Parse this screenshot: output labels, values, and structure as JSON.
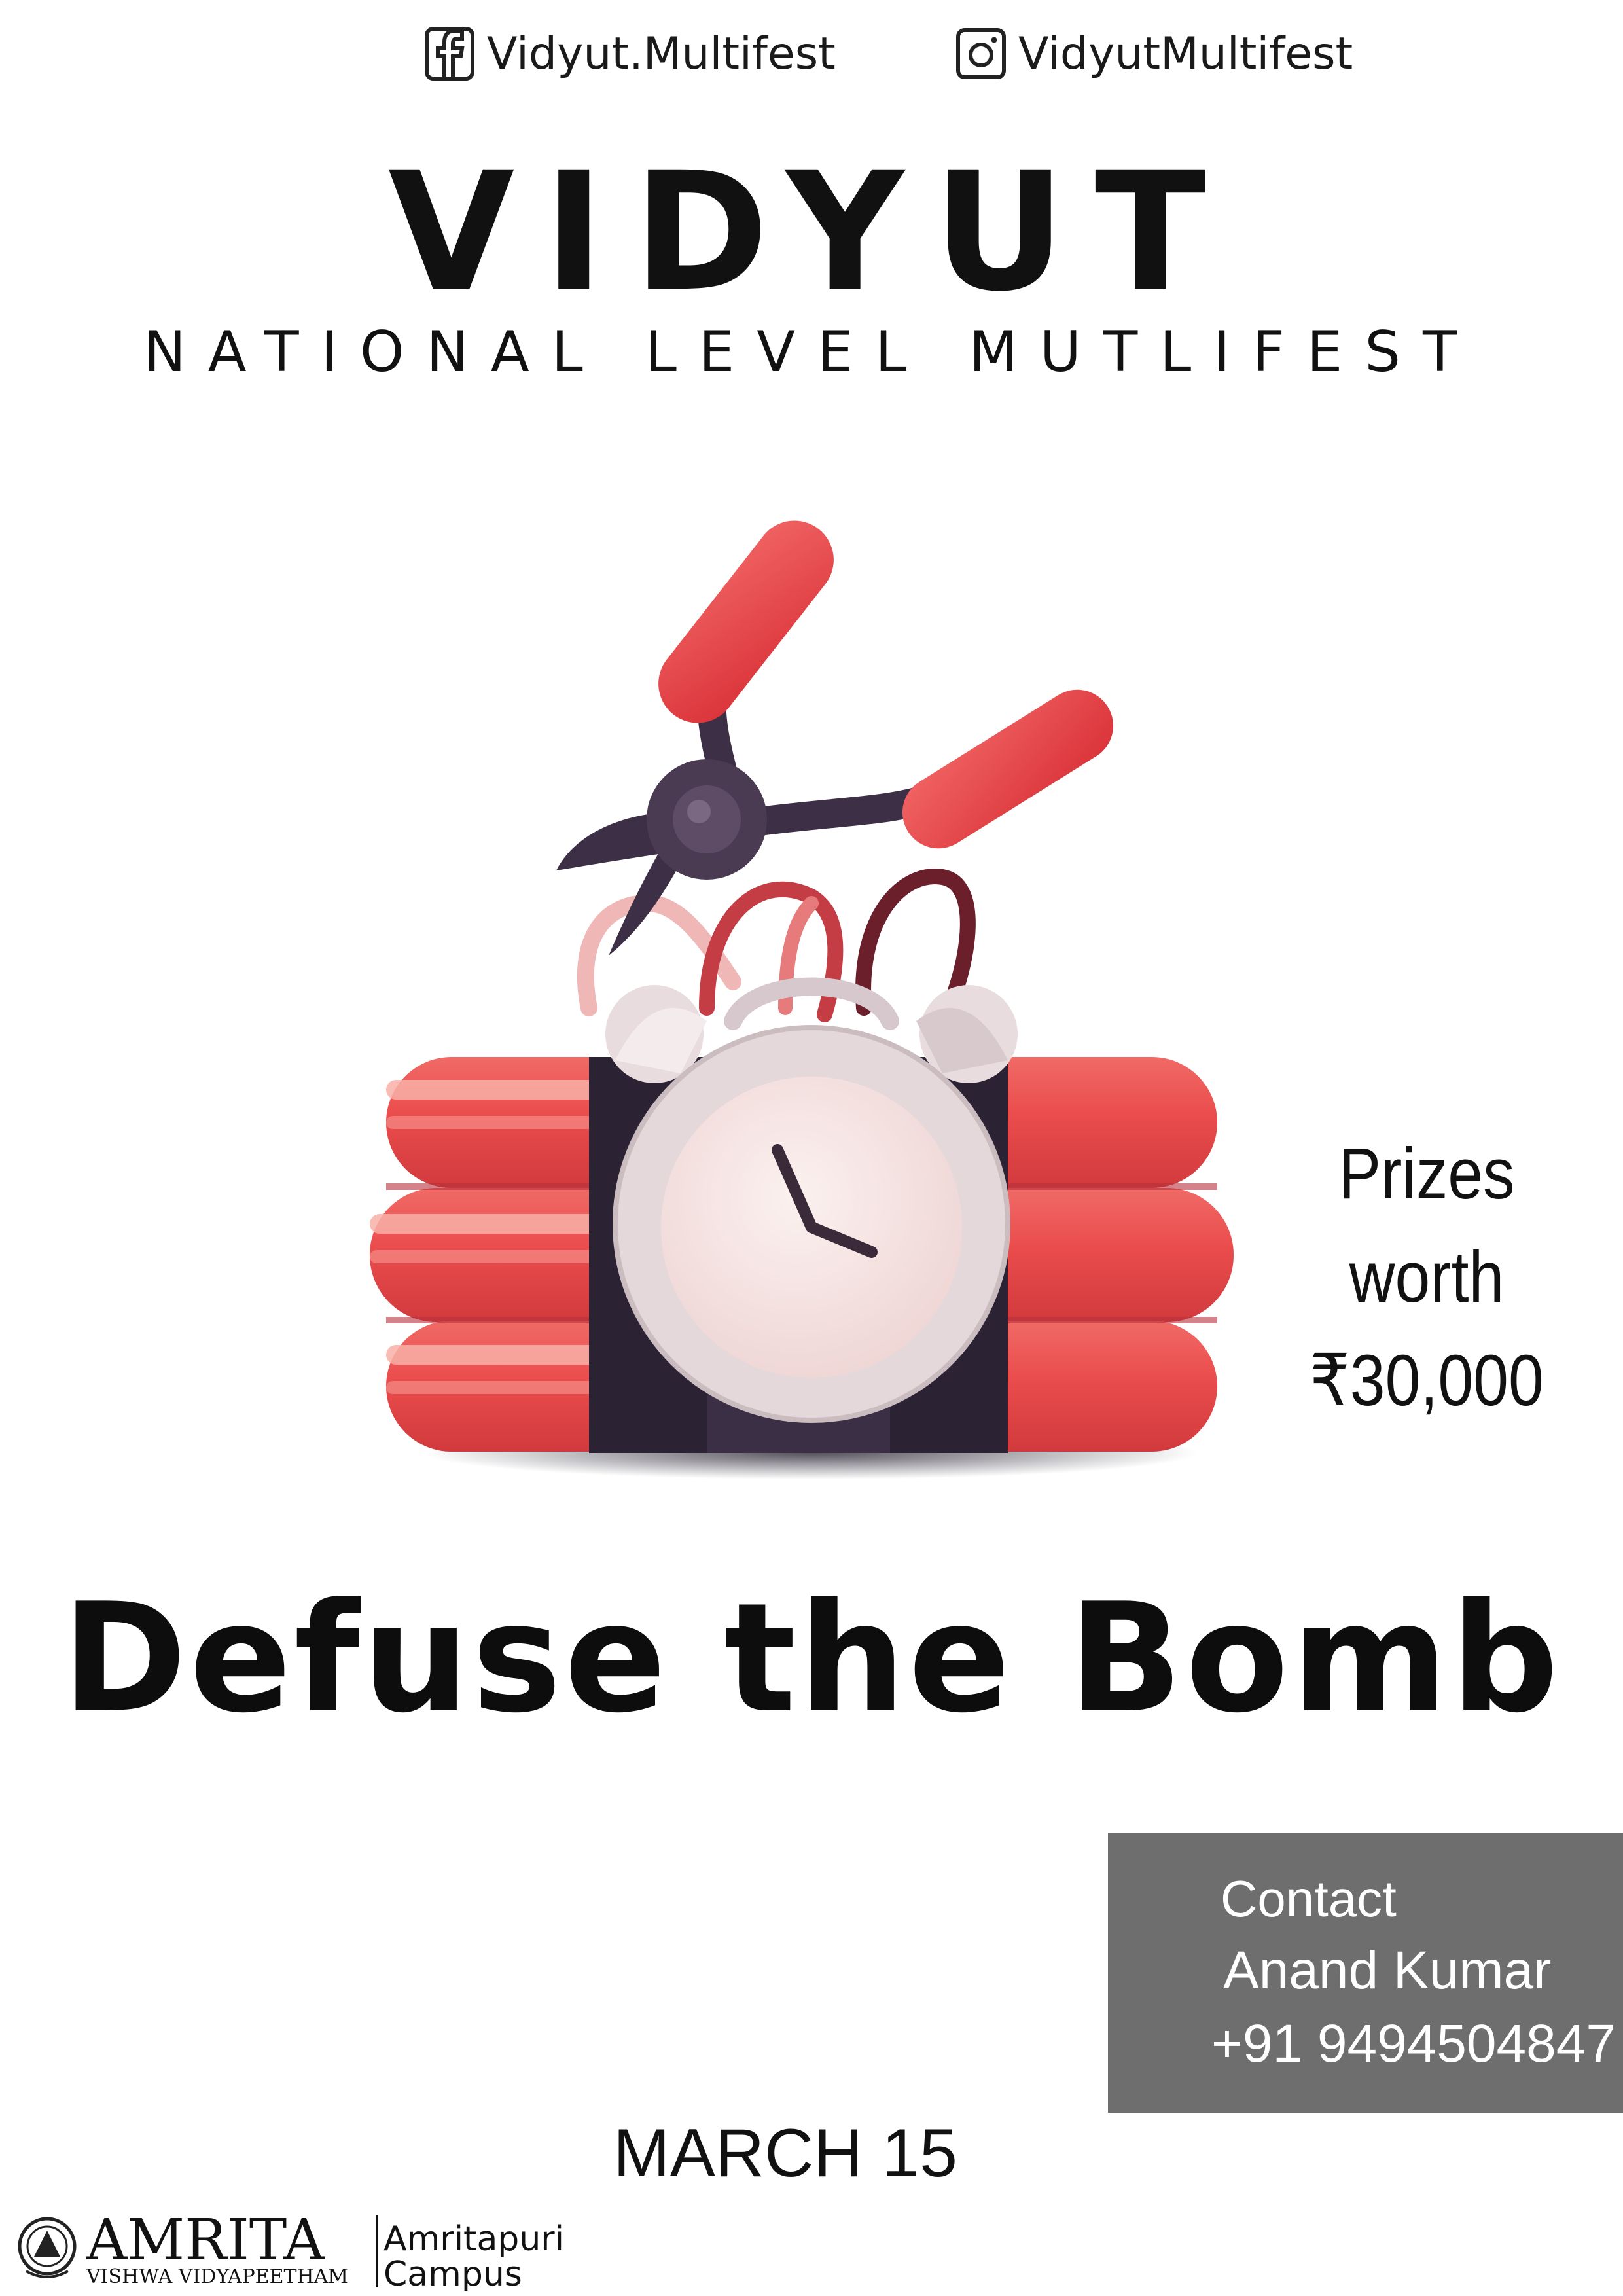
{
  "social": {
    "facebook": {
      "icon": "facebook-icon",
      "handle": "Vidyut.Multifest"
    },
    "instagram": {
      "icon": "instagram-icon",
      "handle": "VidyutMultifest"
    }
  },
  "header": {
    "title": "VIDYUT",
    "subtitle": "NATIONAL LEVEL MUTLIFEST"
  },
  "illustration": {
    "subject": "bomb-with-alarm-clock-and-wire-cutters",
    "colors": {
      "dynamite_red": "#e84a4a",
      "band_dark": "#2b2333",
      "clock_white": "#f3e9ea",
      "pliers_handle": "#e63d3d",
      "pliers_metal": "#3d2f45"
    }
  },
  "prizes": {
    "line1": "Prizes worth",
    "line2": "₹30,000"
  },
  "event": {
    "name": "Defuse the Bomb"
  },
  "contact": {
    "label": "Contact",
    "name": "Anand Kumar",
    "phone": "+91 9494504847",
    "box_color": "#6e6e6e"
  },
  "date": "MARCH 15",
  "footer": {
    "logo_icon": "amrita-emblem-icon",
    "brand": "AMRITA",
    "brand_sub": "VISHWA VIDYAPEETHAM",
    "campus_line1": "Amritapuri",
    "campus_line2": "Campus"
  }
}
